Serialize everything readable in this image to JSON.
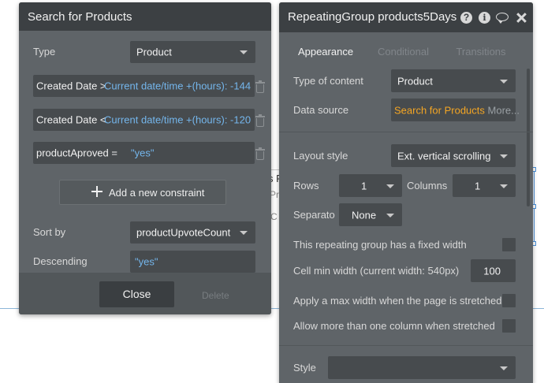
{
  "background": {
    "text_fragment_1": "s F",
    "text_fragment_2": "Pr",
    "text_fragment_3": "C"
  },
  "search_panel": {
    "title": "Search for Products",
    "type_label": "Type",
    "type_value": "Product",
    "constraints": [
      {
        "field": "Created Date >",
        "value": "Current date/time +(hours): -144"
      },
      {
        "field": "Created Date <",
        "value": "Current date/time +(hours): -120"
      },
      {
        "field": "productAproved =",
        "value": "\"yes\""
      }
    ],
    "add_constraint_label": "Add a new constraint",
    "sort_by_label": "Sort by",
    "sort_by_value": "productUpvoteCount",
    "descending_label": "Descending",
    "descending_value": "\"yes\"",
    "close_label": "Close",
    "delete_label": "Delete"
  },
  "rg_panel": {
    "title": "RepeatingGroup products5Days",
    "tabs": [
      {
        "label": "Appearance",
        "active": true
      },
      {
        "label": "Conditional",
        "active": false
      },
      {
        "label": "Transitions",
        "active": false
      }
    ],
    "type_of_content_label": "Type of content",
    "type_of_content_value": "Product",
    "data_source_label": "Data source",
    "data_source_value": "Search for Products",
    "data_source_more": "More...",
    "layout_style_label": "Layout style",
    "layout_style_value": "Ext. vertical scrolling",
    "rows_label": "Rows",
    "rows_value": "1",
    "columns_label": "Columns",
    "columns_value": "1",
    "separator_label": "Separato",
    "separator_value": "None",
    "fixed_width_label": "This repeating group has a fixed width",
    "cell_min_width_label": "Cell min width (current width: 540px)",
    "cell_min_width_value": "100",
    "max_width_label": "Apply a max width when the page is stretched",
    "more_columns_label": "Allow more than one column when stretched",
    "style_label": "Style",
    "style_value": ""
  },
  "colors": {
    "panel_bg": "#5f6468",
    "header_bg": "#3c4043",
    "input_bg": "#474b4e",
    "dynamic_text": "#74b6ec",
    "data_source_text": "#f5a623"
  }
}
